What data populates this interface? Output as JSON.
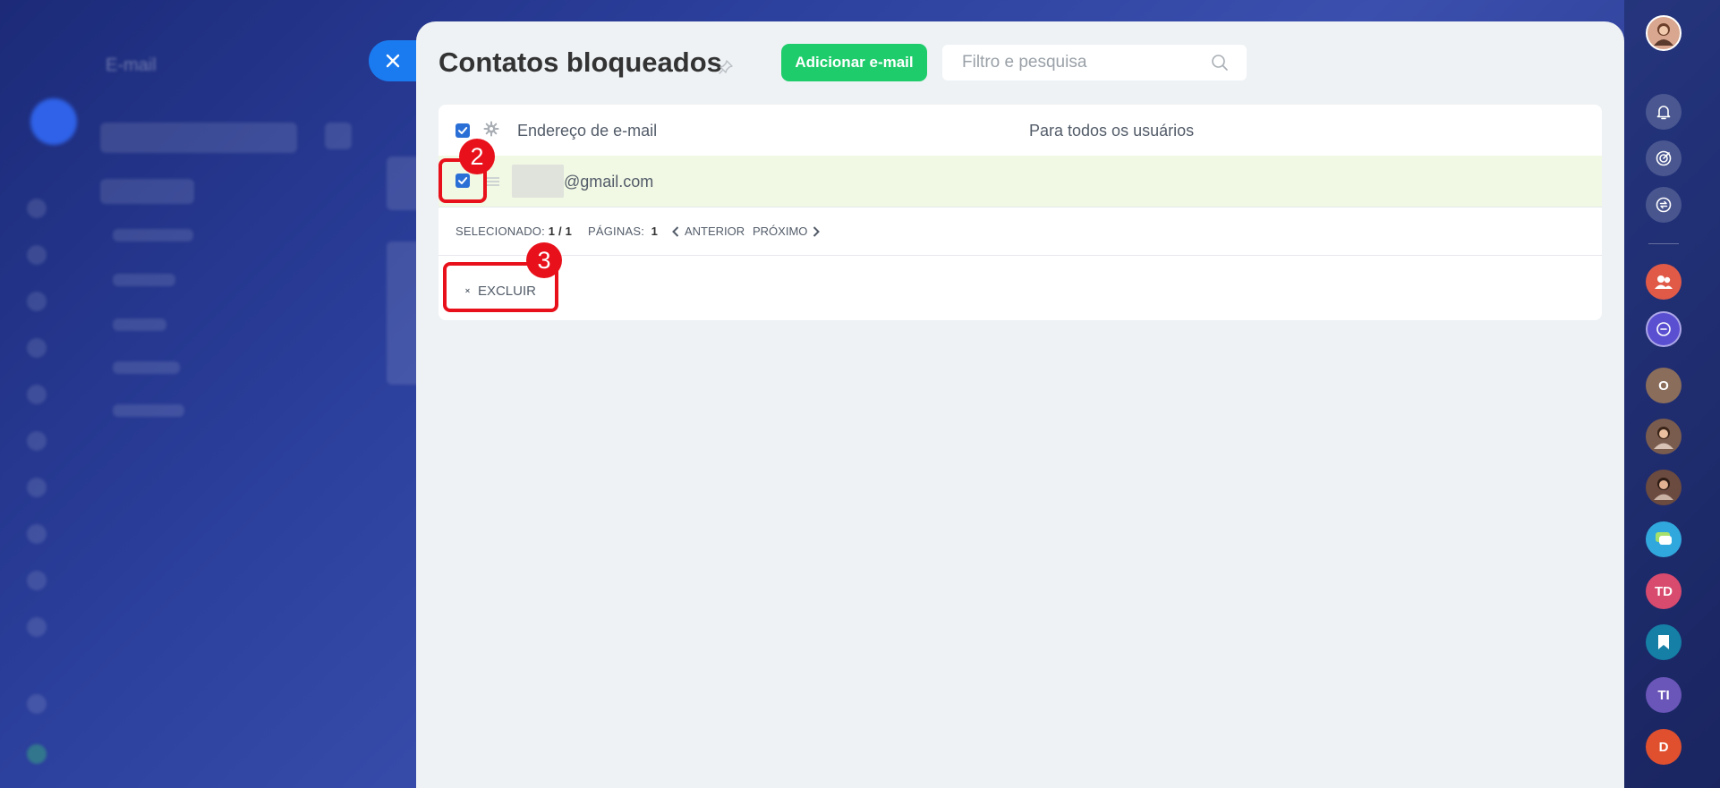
{
  "panel": {
    "title": "Contatos bloqueados",
    "add_button_label": "Adicionar e-mail",
    "search_placeholder": "Filtro e pesquisa"
  },
  "table": {
    "columns": [
      "Endereço de e-mail",
      "Para todos os usuários"
    ],
    "rows": [
      {
        "email": "@gmail.com",
        "for_all_users": ""
      }
    ]
  },
  "footer": {
    "selected_label": "SELECIONADO:",
    "selected_value": "1 / 1",
    "pages_label": "PÁGINAS:",
    "pages_value": "1",
    "prev_label": "ANTERIOR",
    "next_label": "PRÓXIMO"
  },
  "actions": {
    "delete_label": "EXCLUIR"
  },
  "annotations": [
    "2",
    "3"
  ],
  "sidebar": {
    "items": [
      {
        "icon": "bell-icon"
      },
      {
        "icon": "target-icon"
      },
      {
        "icon": "sync-icon"
      },
      {
        "icon": "group-icon",
        "color": "#e05a47"
      },
      {
        "icon": "link-icon",
        "color": "#5b4fd1"
      },
      {
        "initials": "O",
        "color": "#8a6d5b"
      },
      {
        "icon": "avatar-icon",
        "color": "#7a5c4e"
      },
      {
        "icon": "avatar-icon",
        "color": "#6b4a3f"
      },
      {
        "icon": "chat-icon",
        "color": "#31a8dd"
      },
      {
        "initials": "TD",
        "color": "#d84a6e"
      },
      {
        "icon": "bookmark-icon",
        "color": "#157fa6"
      },
      {
        "initials": "TI",
        "color": "#6a55b8"
      },
      {
        "initials": "D",
        "color": "#e0502f"
      }
    ]
  },
  "colors": {
    "accent_green": "#1fcc6b",
    "close_blue": "#1a7bf0",
    "annotation_red": "#e8111b",
    "selected_row": "#f1f8e4"
  }
}
